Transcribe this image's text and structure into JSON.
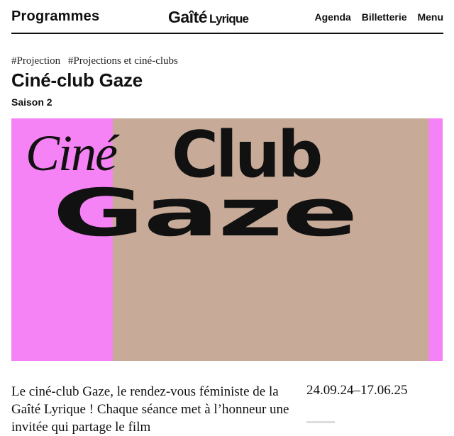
{
  "header": {
    "programmes": "Programmes",
    "logo_main": "Gaîté",
    "logo_sub": "Lyrique",
    "nav": [
      "Agenda",
      "Billetterie",
      "Menu"
    ]
  },
  "event": {
    "tags": [
      "#Projection",
      "#Projections et ciné-clubs"
    ],
    "title": "Ciné-club Gaze",
    "subtitle": "Saison 2",
    "poster": {
      "line1_italic": "Ciné",
      "line1_bold": "Club",
      "line2": "Gaze",
      "colors": {
        "pink": "#f583f5",
        "beige": "#c7aa97"
      }
    },
    "intro": "Le ciné-club Gaze, le rendez-vous féministe de la Gaîté Lyrique ! Chaque séance met à l’honneur une invitée qui partage le film",
    "dates": "24.09.24–17.06.25"
  }
}
